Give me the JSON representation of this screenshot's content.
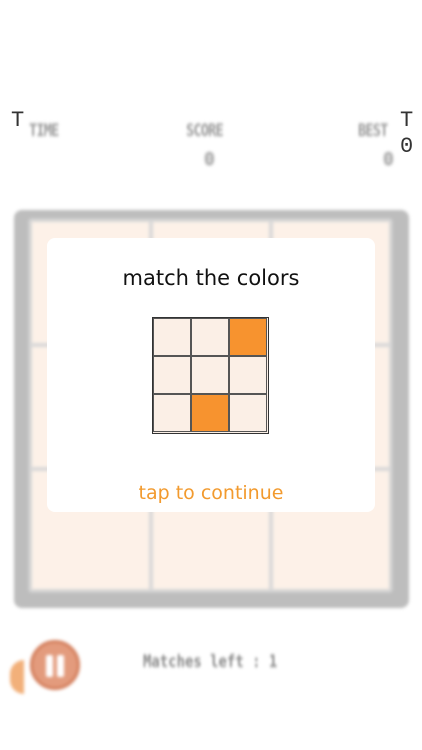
{
  "header": {
    "time_label": "TIME",
    "score_label": "SCORE",
    "score_value": "0",
    "best_label": "BEST",
    "best_value": "0",
    "left_edge_char": "T",
    "right_edge_char_top": "T",
    "right_edge_char_bottom": "0"
  },
  "board": {
    "rows": 3,
    "cols": 3,
    "cell_color": "#fdf1e8"
  },
  "overlay": {
    "title": "match the colors",
    "cta": "tap to continue",
    "example_grid": [
      [
        false,
        false,
        true
      ],
      [
        false,
        false,
        false
      ],
      [
        false,
        true,
        false
      ]
    ],
    "on_color": "#f7932f",
    "off_color": "#fbefe6"
  },
  "footer": {
    "pause_icon": "pause-icon",
    "matches_left": "Matches left : 1"
  }
}
